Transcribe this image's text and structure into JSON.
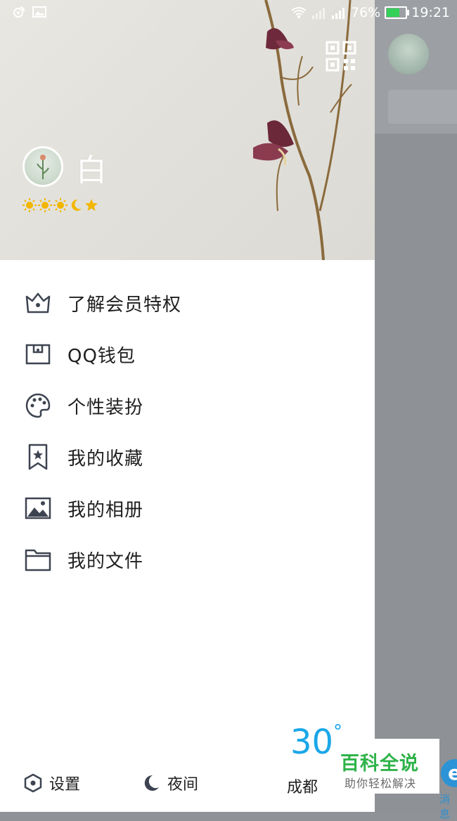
{
  "status_bar": {
    "battery_percent": "76%",
    "time": "19:21",
    "battery_level": 0.76,
    "battery_color": "#34d058"
  },
  "profile": {
    "nickname": "白",
    "level_icons": [
      "sun-icon",
      "sun-icon",
      "sun-icon",
      "moon-icon",
      "star-icon"
    ]
  },
  "menu": {
    "items": [
      {
        "label": "了解会员特权",
        "icon": "crown-icon"
      },
      {
        "label": "QQ钱包",
        "icon": "wallet-icon"
      },
      {
        "label": "个性装扮",
        "icon": "palette-icon"
      },
      {
        "label": "我的收藏",
        "icon": "bookmark-star-icon"
      },
      {
        "label": "我的相册",
        "icon": "photo-icon"
      },
      {
        "label": "我的文件",
        "icon": "folder-icon"
      }
    ]
  },
  "bottom_bar": {
    "settings_label": "设置",
    "night_label": "夜间",
    "city": "成都",
    "temperature": "30",
    "degree_symbol": "°"
  },
  "background_app": {
    "tab_label": "消息"
  },
  "watermark": {
    "title": "百科全说",
    "subtitle": "助你轻松解决"
  },
  "colors": {
    "accent": "#1aa7e8",
    "overlay": "#8f9296",
    "watermark_green": "#2fb34a"
  }
}
